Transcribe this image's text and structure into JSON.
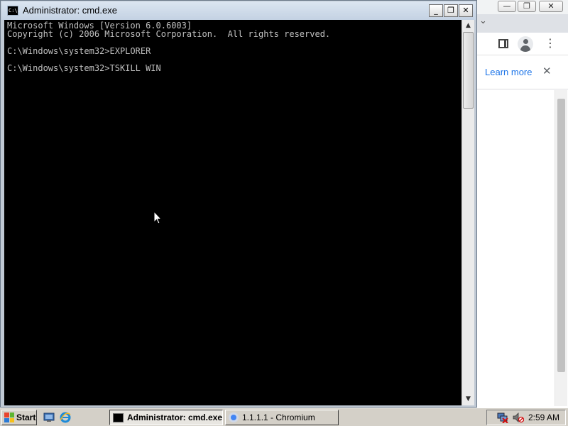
{
  "cmd_window": {
    "title": "Administrator: cmd.exe",
    "icon_text": "C:\\.",
    "controls": {
      "minimize": "_",
      "restore": "❐",
      "close": "✕"
    },
    "console_lines": [
      "Microsoft Windows [Version 6.0.6003]",
      "Copyright (c) 2006 Microsoft Corporation.  All rights reserved.",
      "",
      "C:\\Windows\\system32>EXPLORER",
      "",
      "C:\\Windows\\system32>TSKILL WIN"
    ]
  },
  "chromium_window": {
    "controls": {
      "minimize": "—",
      "restore": "❐",
      "close": "✕"
    },
    "infobar": {
      "learn_more": "Learn more",
      "close_glyph": "✕"
    },
    "menu_glyph": "⋮",
    "tab_chevron": "⌄"
  },
  "taskbar": {
    "start_label": "Start",
    "quick_launch": [
      "show-desktop-icon",
      "internet-explorer-icon"
    ],
    "tasks": [
      {
        "label": "Administrator: cmd.exe",
        "active": true
      },
      {
        "label": "1.1.1.1 - Chromium",
        "active": false
      }
    ],
    "clock": "2:59 AM"
  },
  "colors": {
    "console_bg": "#000000",
    "console_fg": "#c0c0c0",
    "taskbar_bg": "#d4d0c8",
    "link_blue": "#1a73e8"
  }
}
